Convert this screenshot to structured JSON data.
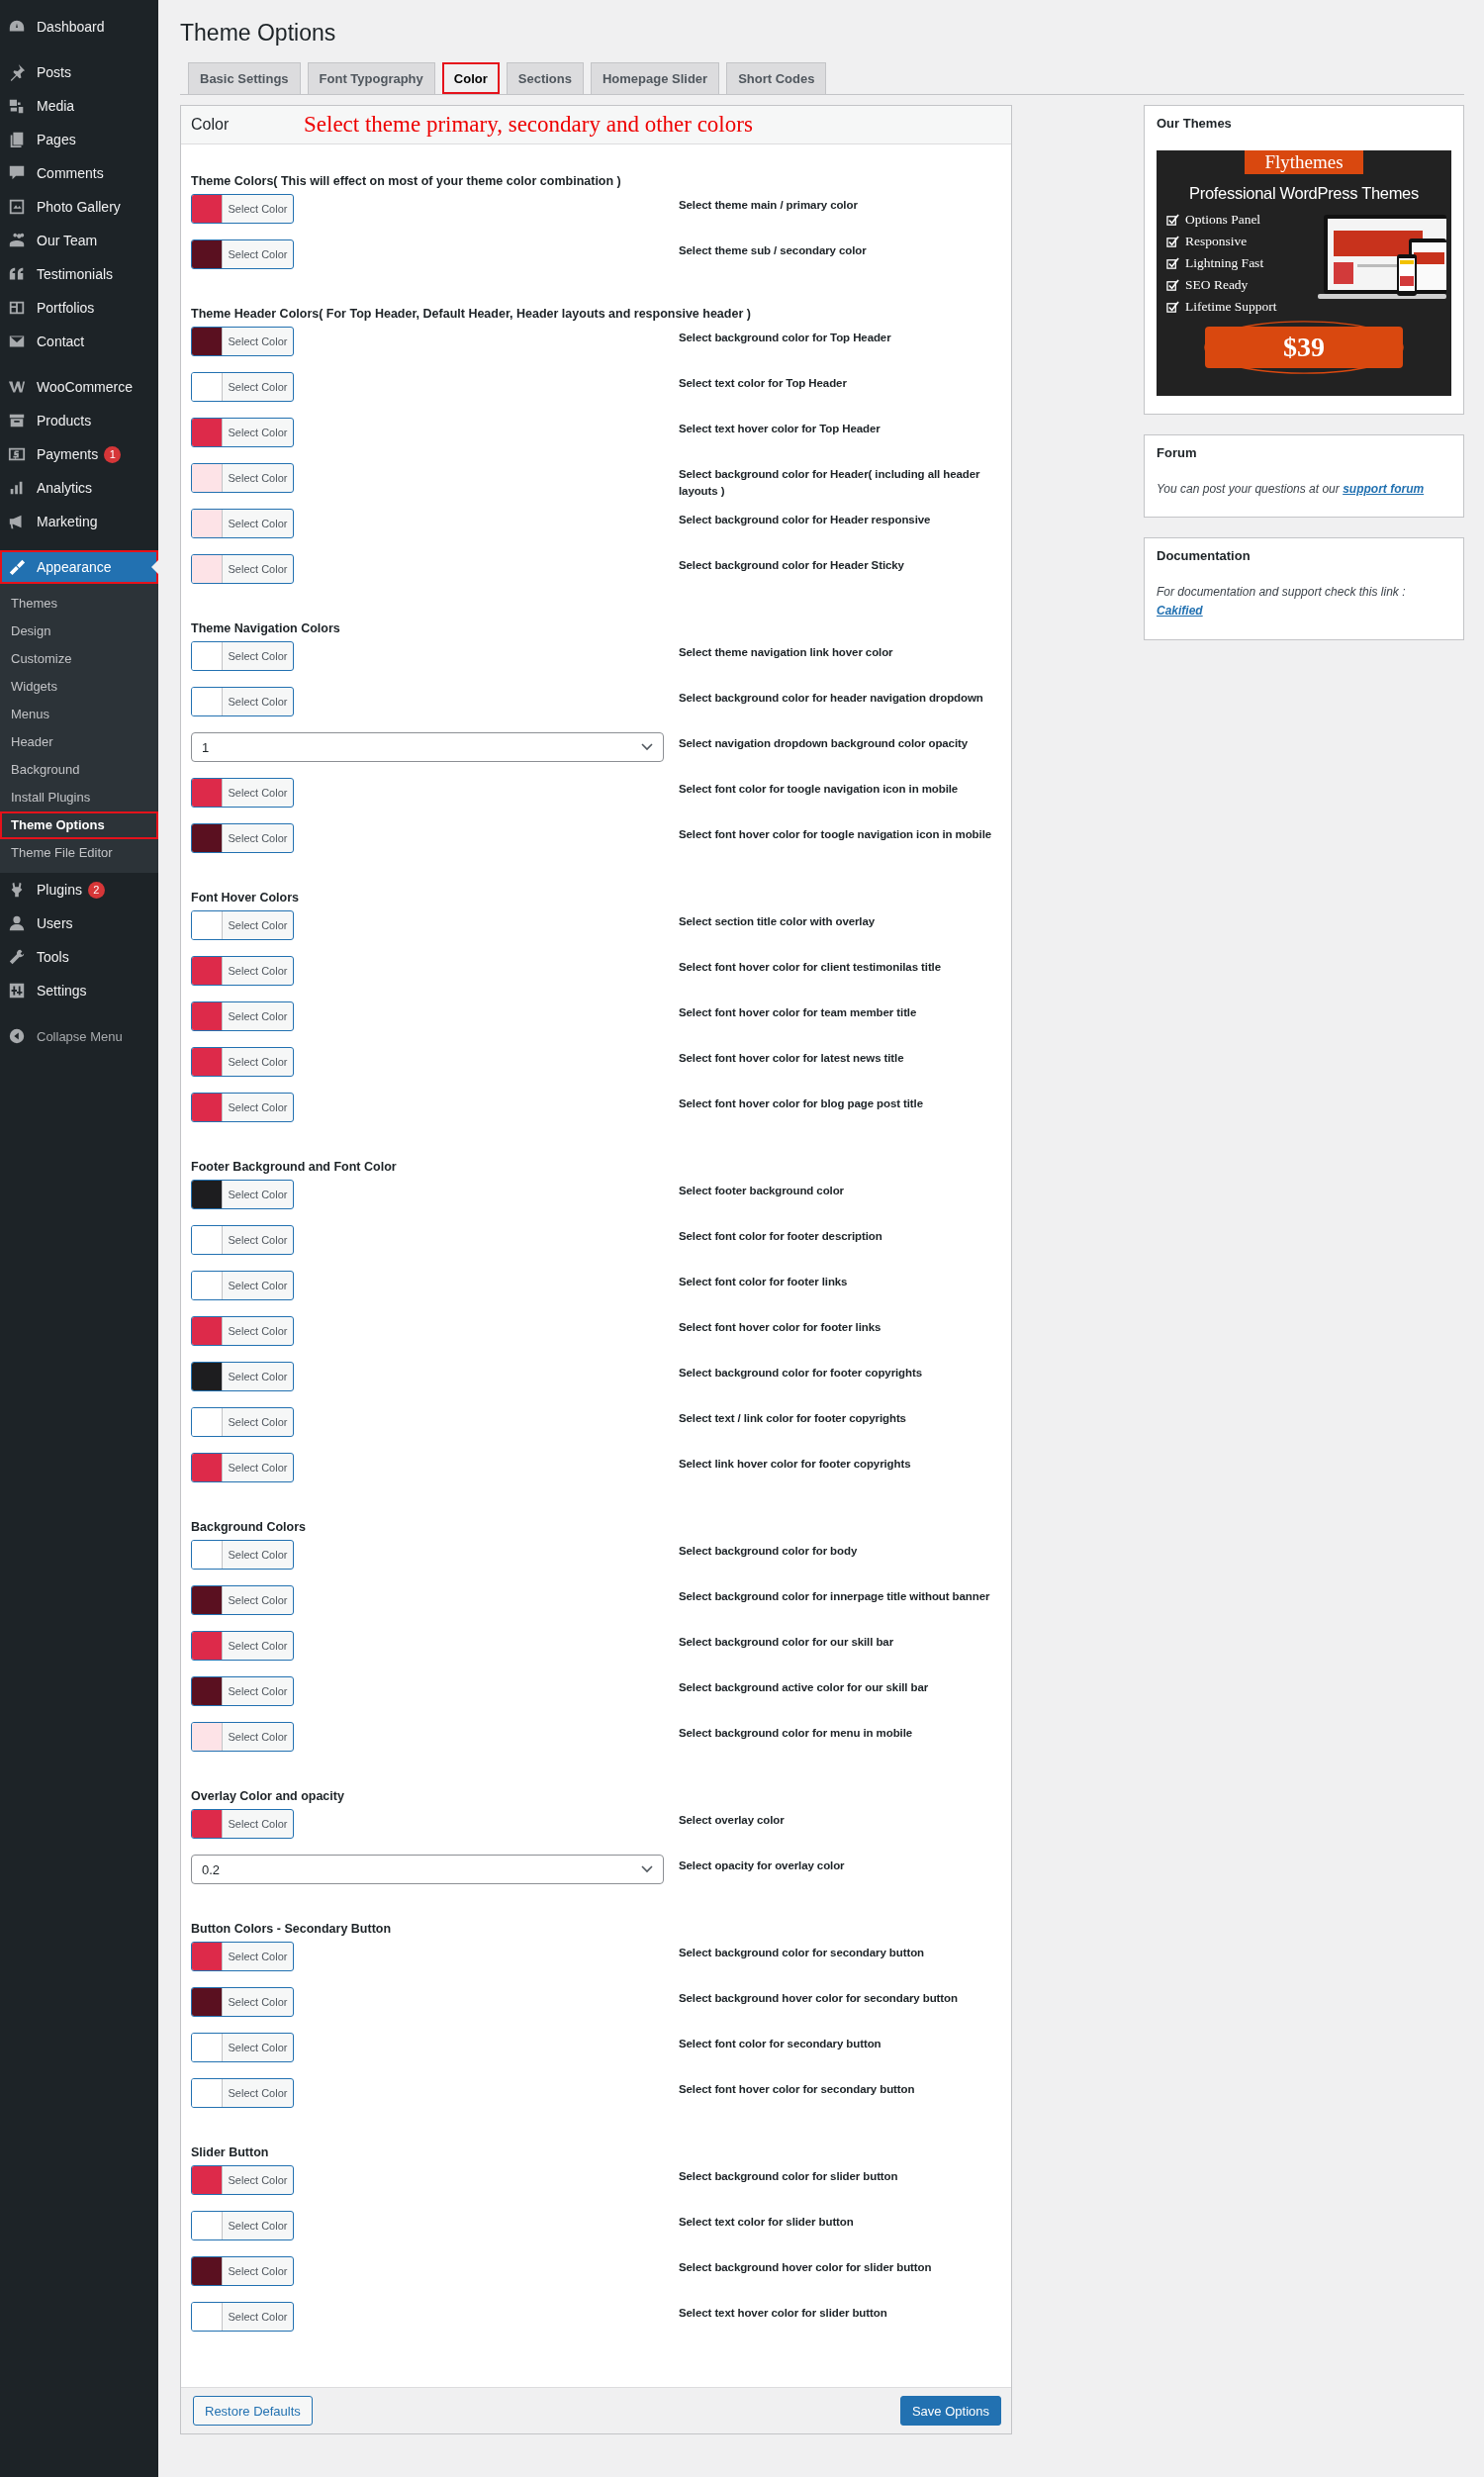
{
  "sidebar": {
    "menu_groups": [
      [
        {
          "label": "Dashboard",
          "selected": false,
          "highlighted": false
        }
      ],
      [
        {
          "label": "Posts",
          "selected": false,
          "highlighted": false
        },
        {
          "label": "Media",
          "selected": false,
          "highlighted": false
        },
        {
          "label": "Pages",
          "selected": false,
          "highlighted": false
        },
        {
          "label": "Comments",
          "selected": false,
          "highlighted": false
        },
        {
          "label": "Photo Gallery",
          "selected": false,
          "highlighted": false
        },
        {
          "label": "Our Team",
          "selected": false,
          "highlighted": false
        },
        {
          "label": "Testimonials",
          "selected": false,
          "highlighted": false
        },
        {
          "label": "Portfolios",
          "selected": false,
          "highlighted": false
        },
        {
          "label": "Contact",
          "selected": false,
          "highlighted": false
        }
      ],
      [
        {
          "label": "WooCommerce",
          "selected": false,
          "highlighted": false
        },
        {
          "label": "Products",
          "selected": false,
          "highlighted": false
        },
        {
          "label": "Payments",
          "badge": "1",
          "selected": false,
          "highlighted": false
        },
        {
          "label": "Analytics",
          "selected": false,
          "highlighted": false
        },
        {
          "label": "Marketing",
          "selected": false,
          "highlighted": false
        }
      ],
      [
        {
          "label": "Appearance",
          "selected": true,
          "highlighted": true,
          "children": [
            {
              "label": "Themes",
              "selected": false,
              "highlighted": false
            },
            {
              "label": "Design",
              "selected": false,
              "highlighted": false
            },
            {
              "label": "Customize",
              "selected": false,
              "highlighted": false
            },
            {
              "label": "Widgets",
              "selected": false,
              "highlighted": false
            },
            {
              "label": "Menus",
              "selected": false,
              "highlighted": false
            },
            {
              "label": "Header",
              "selected": false,
              "highlighted": false
            },
            {
              "label": "Background",
              "selected": false,
              "highlighted": false
            },
            {
              "label": "Install Plugins",
              "selected": false,
              "highlighted": false
            },
            {
              "label": "Theme Options",
              "selected": true,
              "highlighted": true
            },
            {
              "label": "Theme File Editor",
              "selected": false,
              "highlighted": false
            }
          ]
        },
        {
          "label": "Plugins",
          "badge": "2",
          "selected": false,
          "highlighted": false
        },
        {
          "label": "Users",
          "selected": false,
          "highlighted": false
        },
        {
          "label": "Tools",
          "selected": false,
          "highlighted": false
        },
        {
          "label": "Settings",
          "selected": false,
          "highlighted": false
        }
      ]
    ],
    "collapse_label": "Collapse Menu"
  },
  "page_title": "Theme Options",
  "tabs": [
    {
      "label": "Basic Settings",
      "selected": false,
      "highlighted": false
    },
    {
      "label": "Font Typography",
      "selected": false,
      "highlighted": false
    },
    {
      "label": "Color",
      "selected": true,
      "highlighted": true
    },
    {
      "label": "Sections",
      "selected": false,
      "highlighted": false
    },
    {
      "label": "Homepage Slider",
      "selected": false,
      "highlighted": false
    },
    {
      "label": "Short Codes",
      "selected": false,
      "highlighted": false
    }
  ],
  "panel": {
    "title": "Color",
    "annotation": "Select theme primary, secondary and other colors",
    "sections": [
      {
        "heading": "Theme Colors( This will effect on most of your theme color combination )",
        "rows": [
          {
            "kind": "color",
            "color": "#dd2a4a",
            "button": "Select Color",
            "description": "Select theme main / primary color"
          },
          {
            "kind": "color",
            "color": "#5a1020",
            "button": "Select Color",
            "description": "Select theme sub / secondary color"
          }
        ]
      },
      {
        "heading": "Theme Header Colors( For Top Header, Default Header, Header layouts and responsive header )",
        "rows": [
          {
            "kind": "color",
            "color": "#5a1020",
            "button": "Select Color",
            "description": "Select background color for Top Header"
          },
          {
            "kind": "color",
            "color": "#ffffff",
            "button": "Select Color",
            "description": "Select text color for Top Header"
          },
          {
            "kind": "color",
            "color": "#dd2a4a",
            "button": "Select Color",
            "description": "Select text hover color for Top Header"
          },
          {
            "kind": "color",
            "color": "#fde3e7",
            "button": "Select Color",
            "description": "Select background color for Header( including all header layouts )"
          },
          {
            "kind": "color",
            "color": "#fde3e7",
            "button": "Select Color",
            "description": "Select background color for Header responsive"
          },
          {
            "kind": "color",
            "color": "#fde3e7",
            "button": "Select Color",
            "description": "Select background color for Header Sticky"
          }
        ]
      },
      {
        "heading": "Theme Navigation Colors",
        "rows": [
          {
            "kind": "color",
            "color": "#ffffff",
            "button": "Select Color",
            "description": "Select theme navigation link hover color"
          },
          {
            "kind": "color",
            "color": "#ffffff",
            "button": "Select Color",
            "description": "Select background color for header navigation dropdown"
          },
          {
            "kind": "select",
            "value": "1",
            "description": "Select navigation dropdown background color opacity"
          },
          {
            "kind": "color",
            "color": "#dd2a4a",
            "button": "Select Color",
            "description": "Select font color for toogle navigation icon in mobile"
          },
          {
            "kind": "color",
            "color": "#5a1020",
            "button": "Select Color",
            "description": "Select font hover color for toogle navigation icon in mobile"
          }
        ]
      },
      {
        "heading": "Font Hover Colors",
        "rows": [
          {
            "kind": "color",
            "color": "#ffffff",
            "button": "Select Color",
            "description": "Select section title color with overlay"
          },
          {
            "kind": "color",
            "color": "#dd2a4a",
            "button": "Select Color",
            "description": "Select font hover color for client testimonilas title"
          },
          {
            "kind": "color",
            "color": "#dd2a4a",
            "button": "Select Color",
            "description": "Select font hover color for team member title"
          },
          {
            "kind": "color",
            "color": "#dd2a4a",
            "button": "Select Color",
            "description": "Select font hover color for latest news title"
          },
          {
            "kind": "color",
            "color": "#dd2a4a",
            "button": "Select Color",
            "description": "Select font hover color for blog page post title"
          }
        ]
      },
      {
        "heading": "Footer Background and Font Color",
        "rows": [
          {
            "kind": "color",
            "color": "#1d1d1f",
            "button": "Select Color",
            "description": "Select footer background color"
          },
          {
            "kind": "color",
            "color": "#ffffff",
            "button": "Select Color",
            "description": "Select font color for footer description"
          },
          {
            "kind": "color",
            "color": "#ffffff",
            "button": "Select Color",
            "description": "Select font color for footer links"
          },
          {
            "kind": "color",
            "color": "#dd2a4a",
            "button": "Select Color",
            "description": "Select font hover color for footer links"
          },
          {
            "kind": "color",
            "color": "#1d1d1f",
            "button": "Select Color",
            "description": "Select background color for footer copyrights"
          },
          {
            "kind": "color",
            "color": "#ffffff",
            "button": "Select Color",
            "description": "Select text / link color for footer copyrights"
          },
          {
            "kind": "color",
            "color": "#dd2a4a",
            "button": "Select Color",
            "description": "Select link hover color for footer copyrights"
          }
        ]
      },
      {
        "heading": "Background Colors",
        "rows": [
          {
            "kind": "color",
            "color": "#ffffff",
            "button": "Select Color",
            "description": "Select background color for body"
          },
          {
            "kind": "color",
            "color": "#5a1020",
            "button": "Select Color",
            "description": "Select background color for innerpage title without banner"
          },
          {
            "kind": "color",
            "color": "#dd2a4a",
            "button": "Select Color",
            "description": "Select background color for our skill bar"
          },
          {
            "kind": "color",
            "color": "#5a1020",
            "button": "Select Color",
            "description": "Select background active color for our skill bar"
          },
          {
            "kind": "color",
            "color": "#fde3e7",
            "button": "Select Color",
            "description": "Select background color for menu in mobile"
          }
        ]
      },
      {
        "heading": "Overlay Color and opacity",
        "rows": [
          {
            "kind": "color",
            "color": "#dd2a4a",
            "button": "Select Color",
            "description": "Select overlay color"
          },
          {
            "kind": "select",
            "value": "0.2",
            "description": "Select opacity for overlay color"
          }
        ]
      },
      {
        "heading": "Button Colors - Secondary Button",
        "rows": [
          {
            "kind": "color",
            "color": "#dd2a4a",
            "button": "Select Color",
            "description": "Select background color for secondary button"
          },
          {
            "kind": "color",
            "color": "#5a1020",
            "button": "Select Color",
            "description": "Select background hover color for secondary button"
          },
          {
            "kind": "color",
            "color": "#ffffff",
            "button": "Select Color",
            "description": "Select font color for secondary button"
          },
          {
            "kind": "color",
            "color": "#ffffff",
            "button": "Select Color",
            "description": "Select font hover color for secondary button"
          }
        ]
      },
      {
        "heading": "Slider Button",
        "rows": [
          {
            "kind": "color",
            "color": "#dd2a4a",
            "button": "Select Color",
            "description": "Select background color for slider button"
          },
          {
            "kind": "color",
            "color": "#ffffff",
            "button": "Select Color",
            "description": "Select text color for slider button"
          },
          {
            "kind": "color",
            "color": "#5a1020",
            "button": "Select Color",
            "description": "Select background hover color for slider button"
          },
          {
            "kind": "color",
            "color": "#ffffff",
            "button": "Select Color",
            "description": "Select text hover color for slider button"
          }
        ]
      }
    ],
    "footer_buttons": {
      "restore": "Restore Defaults",
      "save": "Save Options"
    }
  },
  "side_boxes": {
    "our_themes": {
      "title": "Our Themes",
      "banner": {
        "brand": "Flythemes",
        "headline": "Professional WordPress Themes",
        "features": [
          "Options Panel",
          "Responsive",
          "Lightning Fast",
          "SEO Ready",
          "Lifetime Support"
        ],
        "price": "$39"
      }
    },
    "forum": {
      "title": "Forum",
      "text": "You can post your questions at our",
      "link": "support forum"
    },
    "documentation": {
      "title": "Documentation",
      "text": "For documentation and support check this link :",
      "link": "Cakified"
    }
  }
}
